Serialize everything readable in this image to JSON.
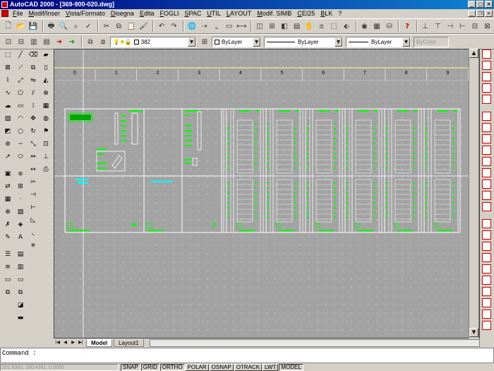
{
  "window": {
    "title": "AutoCAD 2000 - [369-900-020.dwg]"
  },
  "menu": [
    "File",
    "Modif/Inser",
    "Vista/Formato",
    "Disegna",
    "Edita",
    "FOGLI",
    "SPAC",
    "UTIL",
    "LAYOUT",
    "Modif. SIMB",
    "CEI25",
    "BLK",
    "?"
  ],
  "layer_toolbar": {
    "layer_value": "382",
    "color_value": "ByLayer",
    "linetype_value": "ByLayer",
    "lineweight_value": "ByLayer",
    "plotstyle_value": "ByColor"
  },
  "columns": [
    "0",
    "1",
    "2",
    "3",
    "4",
    "5",
    "6",
    "7",
    "8",
    "9"
  ],
  "tabs": {
    "model": "Model",
    "layout": "Layout1"
  },
  "command": {
    "prompt": "Command :"
  },
  "status": {
    "coords": "201.6363, 160.4381, 0.0000",
    "toggles": [
      "SNAP",
      "GRID",
      "ORTHO",
      "POLAR",
      "OSNAP",
      "OTRACK",
      "LWT",
      "MODEL"
    ]
  },
  "colors": {
    "canvas": "#a3a3a3",
    "frame": "#ffffff",
    "green": "#00ff00",
    "cyan": "#00ffff",
    "titlebar": "#000080"
  }
}
